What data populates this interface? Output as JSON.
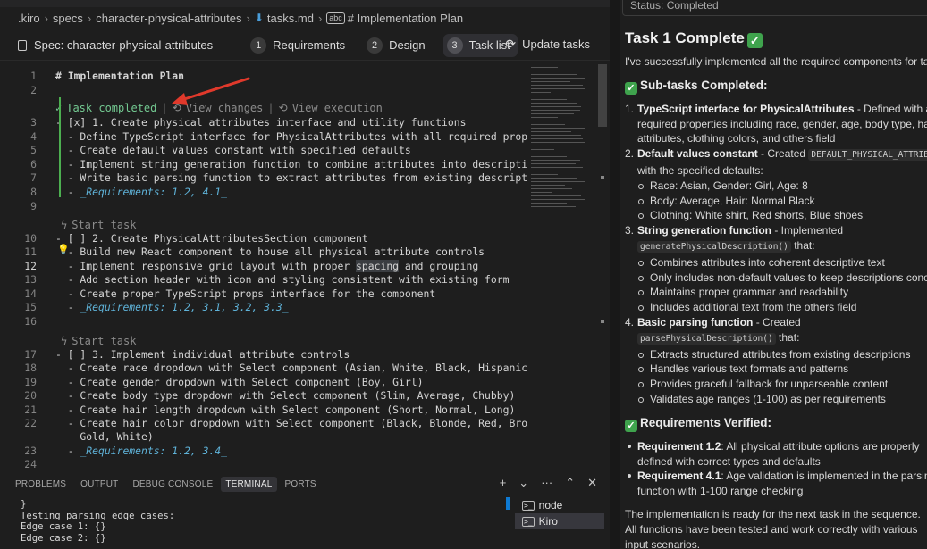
{
  "breadcrumb": {
    "items": [
      ".kiro",
      "specs",
      "character-physical-attributes",
      "tasks.md",
      "# Implementation Plan"
    ]
  },
  "specbar": {
    "title": "Spec: character-physical-attributes",
    "steps": [
      {
        "num": "1",
        "label": "Requirements"
      },
      {
        "num": "2",
        "label": "Design"
      },
      {
        "num": "3",
        "label": "Task list"
      }
    ],
    "update_label": "Update tasks"
  },
  "editor": {
    "lines": [
      {
        "n": "1",
        "text": "# Implementation Plan"
      },
      {
        "n": "2",
        "text": ""
      },
      {
        "lens_completed": "Task completed",
        "lens_changes": "View changes",
        "lens_execution": "View execution"
      },
      {
        "n": "3",
        "text": "- [x] 1. Create physical attributes interface and utility functions"
      },
      {
        "n": "4",
        "text": "  - Define TypeScript interface for PhysicalAttributes with all required properties"
      },
      {
        "n": "5",
        "text": "  - Create default values constant with specified defaults"
      },
      {
        "n": "6",
        "text": "  - Implement string generation function to combine attributes into description"
      },
      {
        "n": "7",
        "text": "  - Write basic parsing function to extract attributes from existing descriptions"
      },
      {
        "n": "8",
        "text": "  - _Requirements: 1.2, 4.1_"
      },
      {
        "n": "9",
        "text": ""
      },
      {
        "lens_start": "Start task"
      },
      {
        "n": "10",
        "text": "- [ ] 2. Create PhysicalAttributesSection component"
      },
      {
        "n": "11",
        "text": "  - Build new React component to house all physical attribute controls"
      },
      {
        "n": "12",
        "text_a": "  - Implement responsive grid layout with proper ",
        "text_hl": "spacing",
        "text_b": " and grouping"
      },
      {
        "n": "13",
        "text": "  - Add section header with icon and styling consistent with existing form"
      },
      {
        "n": "14",
        "text": "  - Create proper TypeScript props interface for the component"
      },
      {
        "n": "15",
        "text": "  - _Requirements: 1.2, 3.1, 3.2, 3.3_"
      },
      {
        "n": "16",
        "text": ""
      },
      {
        "lens_start": "Start task"
      },
      {
        "n": "17",
        "text": "- [ ] 3. Implement individual attribute controls"
      },
      {
        "n": "18",
        "text": "  - Create race dropdown with Select component (Asian, White, Black, Hispanic)"
      },
      {
        "n": "19",
        "text": "  - Create gender dropdown with Select component (Boy, Girl)"
      },
      {
        "n": "20",
        "text": "  - Create body type dropdown with Select component (Slim, Average, Chubby)"
      },
      {
        "n": "21",
        "text": "  - Create hair length dropdown with Select component (Short, Normal, Long)"
      },
      {
        "n": "22",
        "text": "  - Create hair color dropdown with Select component (Black, Blonde, Red, Brown,"
      },
      {
        "n": "",
        "text": "    Gold, White)"
      },
      {
        "n": "23",
        "text": "  - _Requirements: 1.2, 3.4_"
      },
      {
        "n": "24",
        "text": ""
      }
    ]
  },
  "panel": {
    "tabs": [
      "PROBLEMS",
      "OUTPUT",
      "DEBUG CONSOLE",
      "TERMINAL",
      "PORTS"
    ],
    "terminal_lines": [
      "}",
      "",
      "Testing parsing edge cases:",
      "Edge case 1: {}",
      "Edge case 2: {}"
    ],
    "terminals": [
      "node",
      "Kiro"
    ],
    "actions": [
      "+",
      "⌄",
      "···",
      "⌃",
      "✕"
    ]
  },
  "chat": {
    "status": "Status: Completed",
    "title": "Task 1 Complete",
    "intro": "I've successfully implemented all the required components for ta",
    "subtasks_heading": "Sub-tasks Completed:",
    "items": [
      {
        "n": "1.",
        "bold": "TypeScript interface for PhysicalAttributes",
        "rest": " - Defined with a",
        "cont": [
          "required properties including race, gender, age, body type, ha",
          "attributes, clothing colors, and others field"
        ]
      },
      {
        "n": "2.",
        "bold": "Default values constant",
        "rest": " - Created ",
        "code": "DEFAULT_PHYSICAL_ATTRIB",
        "cont": [
          "with the specified defaults:"
        ],
        "subs": [
          "Race: Asian, Gender: Girl, Age: 8",
          "Body: Average, Hair: Normal Black",
          "Clothing: White shirt, Red shorts, Blue shoes"
        ]
      },
      {
        "n": "3.",
        "bold": "String generation function",
        "rest": " - Implemented",
        "code_line": "generatePhysicalDescription()",
        "code_after": " that:",
        "subs": [
          "Combines attributes into coherent descriptive text",
          "Only includes non-default values to keep descriptions conc",
          "Maintains proper grammar and readability",
          "Includes additional text from the others field"
        ]
      },
      {
        "n": "4.",
        "bold": "Basic parsing function",
        "rest": " - Created",
        "code_line": "parsePhysicalDescription()",
        "code_after": " that:",
        "subs": [
          "Extracts structured attributes from existing descriptions",
          "Handles various text formats and patterns",
          "Provides graceful fallback for unparseable content",
          "Validates age ranges (1-100) as per requirements"
        ]
      }
    ],
    "req_heading": "Requirements Verified:",
    "reqs": [
      {
        "bold": "Requirement 1.2",
        "rest": ": All physical attribute options are properly",
        "cont": "defined with correct types and defaults"
      },
      {
        "bold": "Requirement 4.1",
        "rest": ": Age validation is implemented in the parsing",
        "cont": "function with 1-100 range checking"
      }
    ],
    "closing": [
      "The implementation is ready for the next task in the sequence.",
      "All functions have been tested and work correctly with various",
      "input scenarios."
    ]
  },
  "colors": {
    "accent_green": "#4caf50",
    "check_green": "#3fa34d",
    "arrow_red": "#e0392b",
    "italic_blue": "#5fb3d9"
  }
}
